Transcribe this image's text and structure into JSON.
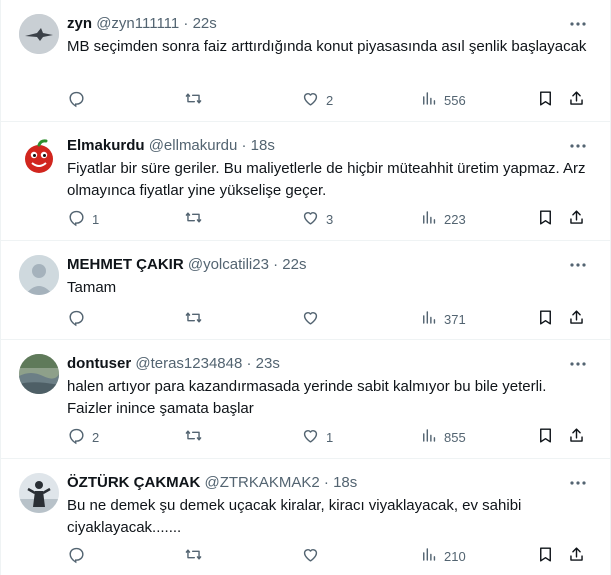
{
  "tweets": [
    {
      "name": "zyn",
      "handle": "@zyn111111",
      "time": "22s",
      "text": "MB seçimden sonra faiz arttırdığında konut piyasasında asıl şenlik başlayacak",
      "replies": "",
      "retweets": "",
      "likes": "2",
      "views": "556"
    },
    {
      "name": "Elmakurdu",
      "handle": "@ellmakurdu",
      "time": "18s",
      "text": "Fiyatlar bir süre geriler. Bu maliyetlerle de hiçbir müteahhit üretim yapmaz. Arz olmayınca fiyatlar yine yükselişe geçer.",
      "replies": "1",
      "retweets": "",
      "likes": "3",
      "views": "223"
    },
    {
      "name": "MEHMET ÇAKIR",
      "handle": "@yolcatili23",
      "time": "22s",
      "text": "Tamam",
      "replies": "",
      "retweets": "",
      "likes": "",
      "views": "371"
    },
    {
      "name": "dontuser",
      "handle": "@teras1234848",
      "time": "23s",
      "text": "halen artıyor para kazandırmasada yerinde sabit kalmıyor bu bile yeterli. Faizler inince şamata başlar",
      "replies": "2",
      "retweets": "",
      "likes": "1",
      "views": "855"
    },
    {
      "name": "ÖZTÜRK ÇAKMAK",
      "handle": "@ZTRKAKMAK2",
      "time": "18s",
      "text": "Bu ne demek şu demek uçacak kiralar, kiracı viyaklayacak, ev sahibi ciyaklayacak.......",
      "replies": "",
      "retweets": "",
      "likes": "",
      "views": "210"
    }
  ],
  "separator": "·",
  "icons": [
    "reply-icon",
    "retweet-icon",
    "like-icon",
    "views-icon",
    "bookmark-icon",
    "share-icon",
    "more-icon"
  ],
  "colors": {
    "text": "#0f1419",
    "secondary": "#536471",
    "border": "#eff3f4"
  }
}
